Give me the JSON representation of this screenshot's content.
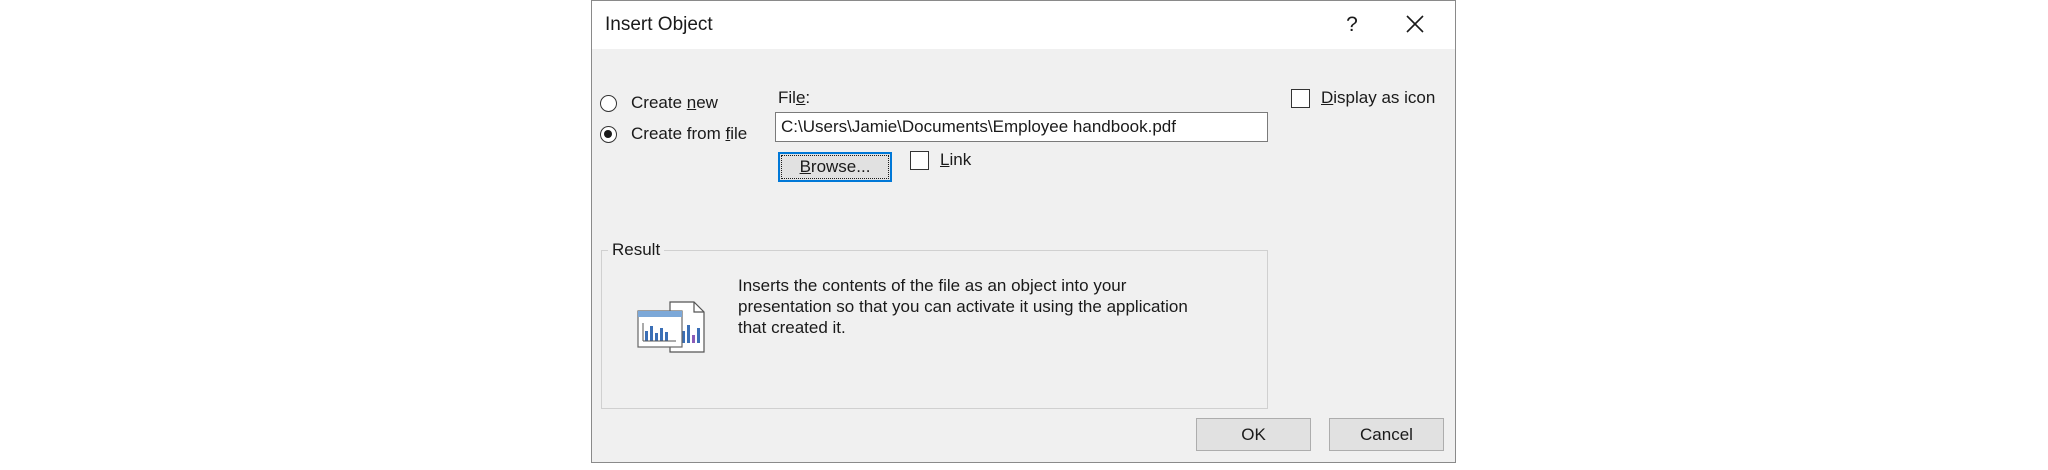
{
  "dialog": {
    "title": "Insert Object",
    "help_label": "?",
    "close_icon": "close-icon"
  },
  "options": {
    "create_new": {
      "prefix": "Create ",
      "accel": "n",
      "suffix": "ew",
      "checked": false
    },
    "create_from_file": {
      "prefix": "Create from ",
      "accel": "f",
      "suffix": "ile",
      "checked": true
    }
  },
  "file": {
    "label_prefix": "Fil",
    "label_accel": "e",
    "label_suffix": ":",
    "value": "C:\\Users\\Jamie\\Documents\\Employee handbook.pdf",
    "browse_accel": "B",
    "browse_rest": "rowse..."
  },
  "link": {
    "accel": "L",
    "rest": "ink",
    "checked": false
  },
  "display_as_icon": {
    "accel": "D",
    "rest": "isplay as icon",
    "checked": false
  },
  "result": {
    "legend": "Result",
    "icon": "embedded-chart-object-icon",
    "line1": "Inserts the contents of the file as an object into your",
    "line2": "presentation so that you can activate it using the application",
    "line3": "that created it."
  },
  "buttons": {
    "ok": "OK",
    "cancel": "Cancel"
  },
  "colors": {
    "dialog_bg": "#f0f0f0",
    "focus_blue": "#0078d7",
    "button_bg": "#e1e1e1"
  }
}
